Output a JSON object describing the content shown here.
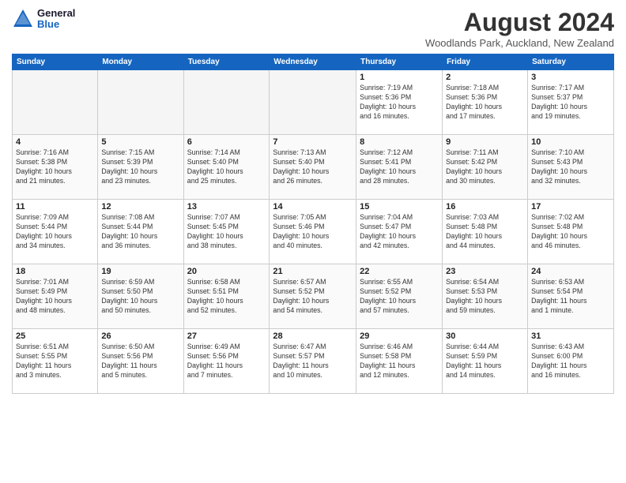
{
  "header": {
    "logo_line1": "General",
    "logo_line2": "Blue",
    "main_title": "August 2024",
    "subtitle": "Woodlands Park, Auckland, New Zealand"
  },
  "calendar": {
    "days_of_week": [
      "Sunday",
      "Monday",
      "Tuesday",
      "Wednesday",
      "Thursday",
      "Friday",
      "Saturday"
    ],
    "weeks": [
      [
        {
          "day": "",
          "info": ""
        },
        {
          "day": "",
          "info": ""
        },
        {
          "day": "",
          "info": ""
        },
        {
          "day": "",
          "info": ""
        },
        {
          "day": "1",
          "info": "Sunrise: 7:19 AM\nSunset: 5:36 PM\nDaylight: 10 hours\nand 16 minutes."
        },
        {
          "day": "2",
          "info": "Sunrise: 7:18 AM\nSunset: 5:36 PM\nDaylight: 10 hours\nand 17 minutes."
        },
        {
          "day": "3",
          "info": "Sunrise: 7:17 AM\nSunset: 5:37 PM\nDaylight: 10 hours\nand 19 minutes."
        }
      ],
      [
        {
          "day": "4",
          "info": "Sunrise: 7:16 AM\nSunset: 5:38 PM\nDaylight: 10 hours\nand 21 minutes."
        },
        {
          "day": "5",
          "info": "Sunrise: 7:15 AM\nSunset: 5:39 PM\nDaylight: 10 hours\nand 23 minutes."
        },
        {
          "day": "6",
          "info": "Sunrise: 7:14 AM\nSunset: 5:40 PM\nDaylight: 10 hours\nand 25 minutes."
        },
        {
          "day": "7",
          "info": "Sunrise: 7:13 AM\nSunset: 5:40 PM\nDaylight: 10 hours\nand 26 minutes."
        },
        {
          "day": "8",
          "info": "Sunrise: 7:12 AM\nSunset: 5:41 PM\nDaylight: 10 hours\nand 28 minutes."
        },
        {
          "day": "9",
          "info": "Sunrise: 7:11 AM\nSunset: 5:42 PM\nDaylight: 10 hours\nand 30 minutes."
        },
        {
          "day": "10",
          "info": "Sunrise: 7:10 AM\nSunset: 5:43 PM\nDaylight: 10 hours\nand 32 minutes."
        }
      ],
      [
        {
          "day": "11",
          "info": "Sunrise: 7:09 AM\nSunset: 5:44 PM\nDaylight: 10 hours\nand 34 minutes."
        },
        {
          "day": "12",
          "info": "Sunrise: 7:08 AM\nSunset: 5:44 PM\nDaylight: 10 hours\nand 36 minutes."
        },
        {
          "day": "13",
          "info": "Sunrise: 7:07 AM\nSunset: 5:45 PM\nDaylight: 10 hours\nand 38 minutes."
        },
        {
          "day": "14",
          "info": "Sunrise: 7:05 AM\nSunset: 5:46 PM\nDaylight: 10 hours\nand 40 minutes."
        },
        {
          "day": "15",
          "info": "Sunrise: 7:04 AM\nSunset: 5:47 PM\nDaylight: 10 hours\nand 42 minutes."
        },
        {
          "day": "16",
          "info": "Sunrise: 7:03 AM\nSunset: 5:48 PM\nDaylight: 10 hours\nand 44 minutes."
        },
        {
          "day": "17",
          "info": "Sunrise: 7:02 AM\nSunset: 5:48 PM\nDaylight: 10 hours\nand 46 minutes."
        }
      ],
      [
        {
          "day": "18",
          "info": "Sunrise: 7:01 AM\nSunset: 5:49 PM\nDaylight: 10 hours\nand 48 minutes."
        },
        {
          "day": "19",
          "info": "Sunrise: 6:59 AM\nSunset: 5:50 PM\nDaylight: 10 hours\nand 50 minutes."
        },
        {
          "day": "20",
          "info": "Sunrise: 6:58 AM\nSunset: 5:51 PM\nDaylight: 10 hours\nand 52 minutes."
        },
        {
          "day": "21",
          "info": "Sunrise: 6:57 AM\nSunset: 5:52 PM\nDaylight: 10 hours\nand 54 minutes."
        },
        {
          "day": "22",
          "info": "Sunrise: 6:55 AM\nSunset: 5:52 PM\nDaylight: 10 hours\nand 57 minutes."
        },
        {
          "day": "23",
          "info": "Sunrise: 6:54 AM\nSunset: 5:53 PM\nDaylight: 10 hours\nand 59 minutes."
        },
        {
          "day": "24",
          "info": "Sunrise: 6:53 AM\nSunset: 5:54 PM\nDaylight: 11 hours\nand 1 minute."
        }
      ],
      [
        {
          "day": "25",
          "info": "Sunrise: 6:51 AM\nSunset: 5:55 PM\nDaylight: 11 hours\nand 3 minutes."
        },
        {
          "day": "26",
          "info": "Sunrise: 6:50 AM\nSunset: 5:56 PM\nDaylight: 11 hours\nand 5 minutes."
        },
        {
          "day": "27",
          "info": "Sunrise: 6:49 AM\nSunset: 5:56 PM\nDaylight: 11 hours\nand 7 minutes."
        },
        {
          "day": "28",
          "info": "Sunrise: 6:47 AM\nSunset: 5:57 PM\nDaylight: 11 hours\nand 10 minutes."
        },
        {
          "day": "29",
          "info": "Sunrise: 6:46 AM\nSunset: 5:58 PM\nDaylight: 11 hours\nand 12 minutes."
        },
        {
          "day": "30",
          "info": "Sunrise: 6:44 AM\nSunset: 5:59 PM\nDaylight: 11 hours\nand 14 minutes."
        },
        {
          "day": "31",
          "info": "Sunrise: 6:43 AM\nSunset: 6:00 PM\nDaylight: 11 hours\nand 16 minutes."
        }
      ]
    ]
  }
}
